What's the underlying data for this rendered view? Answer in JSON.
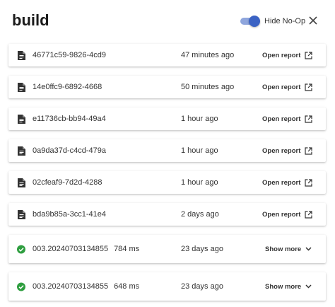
{
  "header": {
    "title": "build",
    "toggle_label": "Hide No-Op",
    "toggle_on": true
  },
  "colors": {
    "accent": "#3b63c4",
    "accent_track": "#8fa6dd",
    "success": "#2e9e3f"
  },
  "builds": [
    {
      "name": "46771c59-9826-4cd9",
      "duration": "",
      "time": "47 minutes ago",
      "action": "Open report",
      "icon": "document-icon",
      "action_icon": "open-external-icon"
    },
    {
      "name": "14e0ffc9-6892-4668",
      "duration": "",
      "time": "50 minutes ago",
      "action": "Open report",
      "icon": "document-icon",
      "action_icon": "open-external-icon"
    },
    {
      "name": "e11736cb-bb94-49a4",
      "duration": "",
      "time": "1 hour ago",
      "action": "Open report",
      "icon": "document-icon",
      "action_icon": "open-external-icon"
    },
    {
      "name": "0a9da37d-c4cd-479a",
      "duration": "",
      "time": "1 hour ago",
      "action": "Open report",
      "icon": "document-icon",
      "action_icon": "open-external-icon"
    },
    {
      "name": "02cfeaf9-7d2d-4288",
      "duration": "",
      "time": "1 hour ago",
      "action": "Open report",
      "icon": "document-icon",
      "action_icon": "open-external-icon"
    },
    {
      "name": "bda9b85a-3cc1-41e4",
      "duration": "",
      "time": "2 days ago",
      "action": "Open report",
      "icon": "document-icon",
      "action_icon": "open-external-icon"
    },
    {
      "name": "003.20240703134855",
      "duration": "784 ms",
      "time": "23 days ago",
      "action": "Show more",
      "icon": "check-circle-icon",
      "action_icon": "chevron-down-icon"
    },
    {
      "name": "003.20240703134855",
      "duration": "648 ms",
      "time": "23 days ago",
      "action": "Show more",
      "icon": "check-circle-icon",
      "action_icon": "chevron-down-icon"
    }
  ]
}
